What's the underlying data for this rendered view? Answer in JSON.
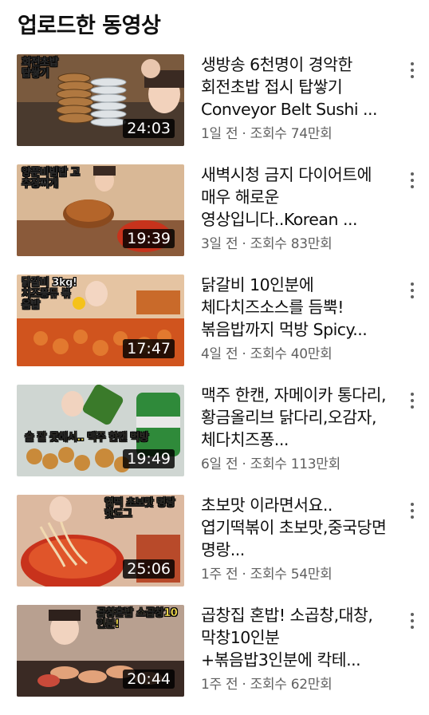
{
  "section_title": "업로드한 동영상",
  "videos": [
    {
      "title": "생방송 6천명이 경악한 회전초밥 접시 탑쌓기 Conveyor Belt Sushi ...",
      "meta": "1일 전 · 조회수 74만회",
      "duration": "24:03",
      "thumb_caption": "회전초밥 탑쌓기",
      "thumb_bg": "#8a6a4a"
    },
    {
      "title": "새벽시청 금지 다이어트에 매우 해로운 영상입니다..Korean ...",
      "meta": "3일 전 · 조회수 83만회",
      "duration": "19:39",
      "thumb_caption": "양푼비빔밥 고추장찌개",
      "thumb_bg": "#c9a27a"
    },
    {
      "title": "닭갈비 10인분에 체다치즈소스를 듬뿍! 볶음밥까지 먹방 Spicy...",
      "meta": "4일 전 · 조회수 40만회",
      "duration": "17:47",
      "thumb_caption": "닭갈비 3kg! 치즈퐁듀 볶음밥",
      "thumb_bg": "#d86a2a"
    },
    {
      "title": "맥주 한캔, 자메이카 통다리,황금올리브 닭다리,오감자,체다치즈퐁...",
      "meta": "6일 전 · 조회수 113만회",
      "duration": "19:49",
      "thumb_caption": "술 잘 못해서.. 맥주 한캔 먹방",
      "thumb_bg": "#3f7a3a"
    },
    {
      "title": "초보맛 이라면서요..엽기떡볶이 초보맛,중국당면 명랑...",
      "meta": "1주 전 · 조회수 54만회",
      "duration": "25:06",
      "thumb_caption": "엽떡 초보맛 명랑핫도그",
      "thumb_bg": "#c0442c"
    },
    {
      "title": "곱창집 혼밥! 소곱창,대창,막창10인분 +볶음밥3인분에 칵테...",
      "meta": "1주 전 · 조회수 62만회",
      "duration": "20:44",
      "thumb_caption": "곱창혼밥 소곱창10인분!",
      "thumb_bg": "#6a4a3a"
    }
  ]
}
